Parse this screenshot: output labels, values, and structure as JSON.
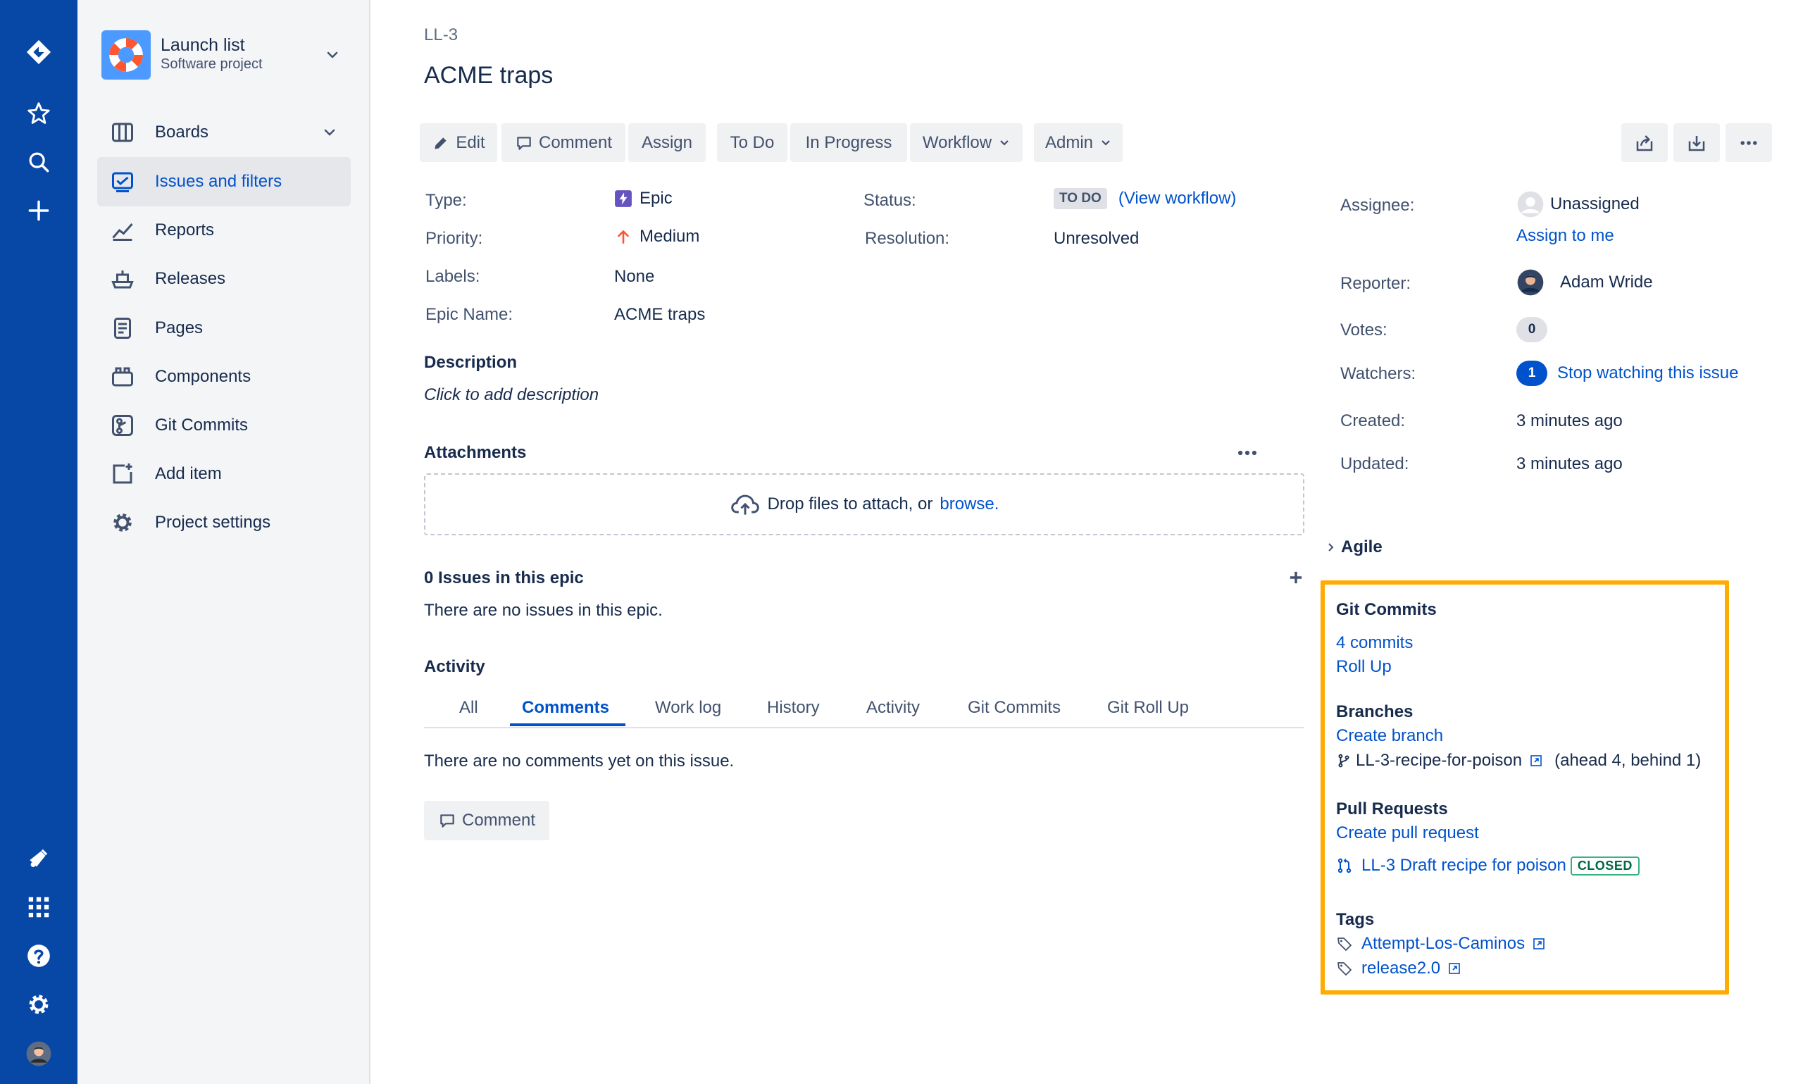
{
  "colors": {
    "nav_bg": "#0747A6",
    "link": "#0052CC",
    "highlight_border": "#FFAB00",
    "closed": "#36B37E"
  },
  "project": {
    "name": "Launch list",
    "type": "Software project"
  },
  "sidebar": {
    "items": [
      {
        "label": "Boards",
        "icon": "board-icon"
      },
      {
        "label": "Issues and filters",
        "icon": "issues-icon"
      },
      {
        "label": "Reports",
        "icon": "reports-icon"
      },
      {
        "label": "Releases",
        "icon": "releases-icon"
      },
      {
        "label": "Pages",
        "icon": "pages-icon"
      },
      {
        "label": "Components",
        "icon": "components-icon"
      },
      {
        "label": "Git Commits",
        "icon": "git-commits-icon"
      },
      {
        "label": "Add item",
        "icon": "add-item-icon"
      },
      {
        "label": "Project settings",
        "icon": "settings-icon"
      }
    ]
  },
  "issue": {
    "key": "LL-3",
    "title": "ACME traps"
  },
  "toolbar": {
    "edit": "Edit",
    "comment": "Comment",
    "assign": "Assign",
    "todo": "To Do",
    "in_progress": "In Progress",
    "workflow": "Workflow",
    "admin": "Admin"
  },
  "details": {
    "type_label": "Type:",
    "type_value": "Epic",
    "priority_label": "Priority:",
    "priority_value": "Medium",
    "labels_label": "Labels:",
    "labels_value": "None",
    "epic_name_label": "Epic Name:",
    "epic_name_value": "ACME traps",
    "status_label": "Status:",
    "status_value": "TO DO",
    "view_workflow": "(View workflow)",
    "resolution_label": "Resolution:",
    "resolution_value": "Unresolved"
  },
  "description": {
    "title": "Description",
    "placeholder": "Click to add description"
  },
  "attachments": {
    "title": "Attachments",
    "drop_text": "Drop files to attach, or",
    "browse": "browse."
  },
  "epic_issues": {
    "title": "0 Issues in this epic",
    "empty": "There are no issues in this epic."
  },
  "activity": {
    "title": "Activity",
    "tabs": [
      "All",
      "Comments",
      "Work log",
      "History",
      "Activity",
      "Git Commits",
      "Git Roll Up"
    ],
    "active_tab": "Comments",
    "empty": "There are no comments yet on this issue.",
    "comment_button": "Comment"
  },
  "people": {
    "assignee_label": "Assignee:",
    "assignee_value": "Unassigned",
    "assign_to_me": "Assign to me",
    "reporter_label": "Reporter:",
    "reporter_value": "Adam Wride",
    "votes_label": "Votes:",
    "votes_value": "0",
    "watchers_label": "Watchers:",
    "watchers_value": "1",
    "stop_watching": "Stop watching this issue",
    "created_label": "Created:",
    "created_value": "3 minutes ago",
    "updated_label": "Updated:",
    "updated_value": "3 minutes ago"
  },
  "agile": {
    "title": "Agile"
  },
  "git_panel": {
    "commits_title": "Git Commits",
    "commits_count": "4 commits",
    "roll_up": "Roll Up",
    "branches_title": "Branches",
    "create_branch": "Create branch",
    "branch_name": "LL-3-recipe-for-poison",
    "branch_status": "(ahead 4, behind 1)",
    "pr_title": "Pull Requests",
    "create_pr": "Create pull request",
    "pr_name": "LL-3 Draft recipe for poison",
    "pr_status": "CLOSED",
    "tags_title": "Tags",
    "tags": [
      "Attempt-Los-Caminos",
      "release2.0"
    ]
  }
}
